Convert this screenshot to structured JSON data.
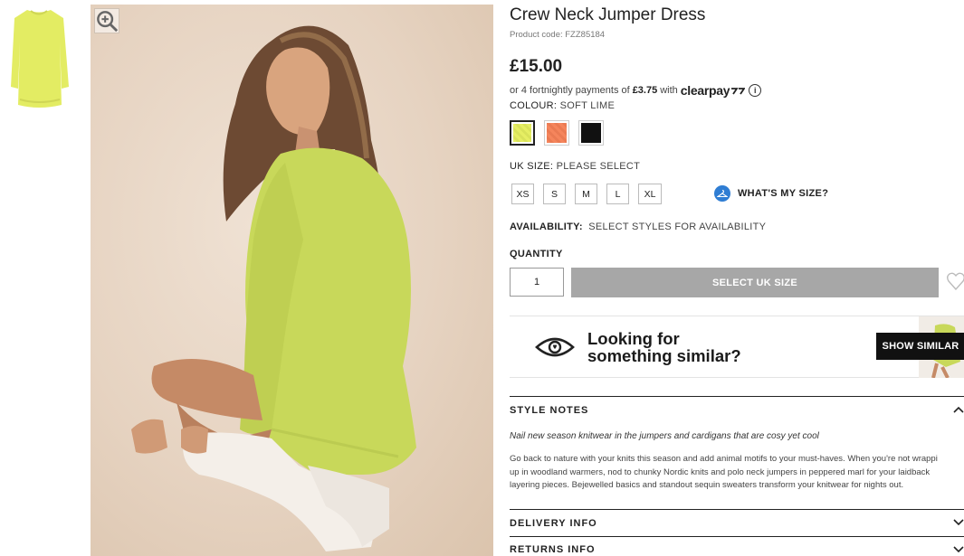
{
  "product": {
    "title": "Crew Neck Jumper Dress",
    "product_code": "Product code: FZZ85184",
    "price": "£15.00"
  },
  "clearpay": {
    "prefix": "or 4 fortnightly payments of",
    "amount": "£3.75",
    "middle": "with",
    "logo_text": "clearpay",
    "info_icon": "info-icon"
  },
  "colour": {
    "label": "COLOUR:",
    "value": "SOFT LIME",
    "options": [
      {
        "name": "Soft Lime",
        "hex": "#e6ee63",
        "selected": true
      },
      {
        "name": "Coral",
        "hex": "#f5855c",
        "selected": false
      },
      {
        "name": "Black",
        "hex": "#111111",
        "selected": false
      }
    ]
  },
  "size": {
    "label": "UK SIZE:",
    "value": "PLEASE SELECT",
    "options": [
      "XS",
      "S",
      "M",
      "L",
      "XL"
    ],
    "whats_my_size": "WHAT'S MY SIZE?"
  },
  "availability": {
    "label": "AVAILABILITY:",
    "value": "SELECT STYLES FOR AVAILABILITY"
  },
  "quantity": {
    "label": "QUANTITY",
    "value": "1"
  },
  "add_button": "SELECT UK SIZE",
  "similar": {
    "line1": "Looking for",
    "line2": "something similar?",
    "button": "SHOW SIMILAR"
  },
  "style_notes": {
    "heading": "STYLE NOTES",
    "lead": "Nail new season knitwear in the jumpers and cardigans that are cosy yet cool",
    "body_lines": [
      "Go back to nature with your knits this season and add animal motifs to your must-haves. When you're not wrappi",
      "up in woodland warmers, nod to chunky Nordic knits and polo neck jumpers in peppered marl for your laidback",
      "layering pieces. Bejewelled basics and standout sequin sweaters transform your knitwear for nights out."
    ]
  },
  "delivery_info": "DELIVERY INFO",
  "returns_info": "RETURNS INFO",
  "colors": {
    "accent_blue": "#2f7dd3",
    "button_grey": "#a7a7a7",
    "dress_lime": "#c8d85a"
  }
}
